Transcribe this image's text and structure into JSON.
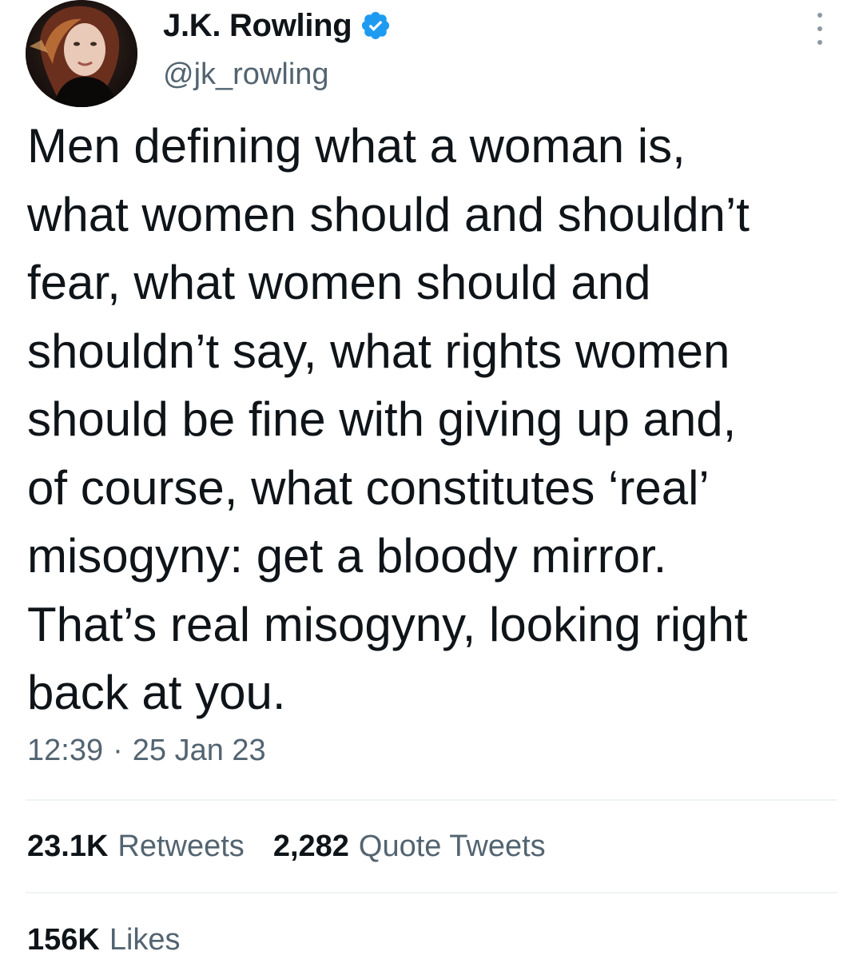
{
  "author": {
    "display_name": "J.K. Rowling",
    "handle": "@jk_rowling",
    "verified_color": "#1d9bf0"
  },
  "icons": {
    "verified": "verified-badge-icon",
    "more": "more-options-icon"
  },
  "tweet": {
    "lines": [
      "Men defining what a woman is,",
      "what women should and shouldn’t",
      "fear, what women should and",
      "shouldn’t say, what rights women",
      "should be fine with giving up and,",
      "of course, what constitutes ‘real’",
      "misogyny: get a bloody mirror.",
      "That’s real misogyny, looking right",
      "back at you."
    ],
    "time": "12:39",
    "separator": "·",
    "date": "25 Jan 23"
  },
  "stats": {
    "retweets_count": "23.1K",
    "retweets_label": "Retweets",
    "quotes_count": "2,282",
    "quotes_label": "Quote Tweets",
    "likes_count": "156K",
    "likes_label": "Likes"
  },
  "colors": {
    "text": "#0f1419",
    "secondary": "#536471",
    "divider": "#eff3f4"
  }
}
